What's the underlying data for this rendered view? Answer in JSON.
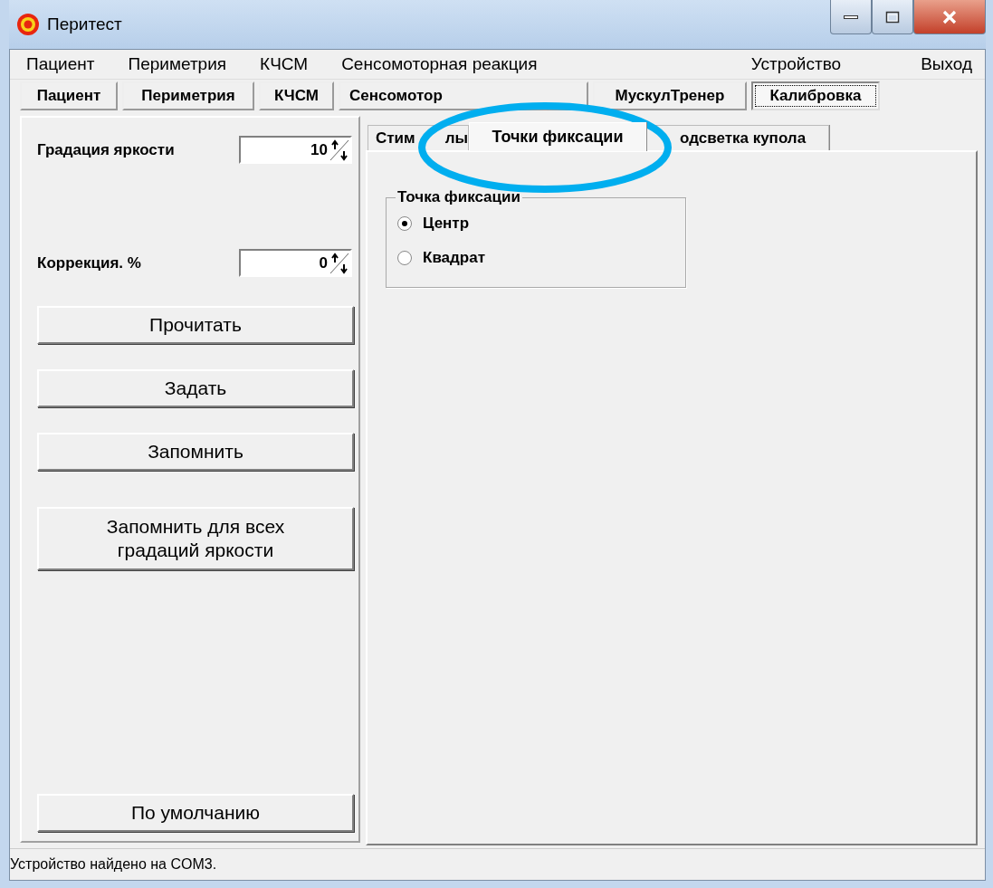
{
  "window": {
    "title": "Перитест"
  },
  "menu": [
    {
      "label": "Пациент"
    },
    {
      "label": "Периметрия"
    },
    {
      "label": "КЧСМ"
    },
    {
      "label": "Сенсомоторная реакция"
    },
    {
      "label": "Устройство"
    },
    {
      "label": "Выход"
    }
  ],
  "toolbar": [
    {
      "label": "Пациент",
      "selected": false
    },
    {
      "label": "Периметрия",
      "selected": false
    },
    {
      "label": "КЧСМ",
      "selected": false
    },
    {
      "label": "Сенсомотор",
      "selected": false
    },
    {
      "label": "МускулТренер",
      "selected": false
    },
    {
      "label": "Калибровка",
      "selected": true
    }
  ],
  "settings": [
    {
      "label": "Градация яркости",
      "value": "10"
    },
    {
      "label": "Коррекция. %",
      "value": "0"
    }
  ],
  "buttons": [
    {
      "label": "Прочитать"
    },
    {
      "label": "Задать"
    },
    {
      "label": "Запомнить"
    },
    {
      "label": "Запомнить для всех градаций яркости"
    },
    {
      "label": "По умолчанию"
    }
  ],
  "tabs": [
    {
      "parts": [
        "Стим",
        "лы"
      ],
      "selected": false
    },
    {
      "parts": [
        "Точки фиксации"
      ],
      "selected": true
    },
    {
      "parts": [
        "одсветка купола"
      ],
      "selected": false
    }
  ],
  "group": {
    "title": "Точка фиксации",
    "options": [
      {
        "label": "Центр",
        "selected": true
      },
      {
        "label": "Квадрат",
        "selected": false
      }
    ]
  },
  "status_bar": {
    "text": "Устройство найдено на COM3."
  }
}
